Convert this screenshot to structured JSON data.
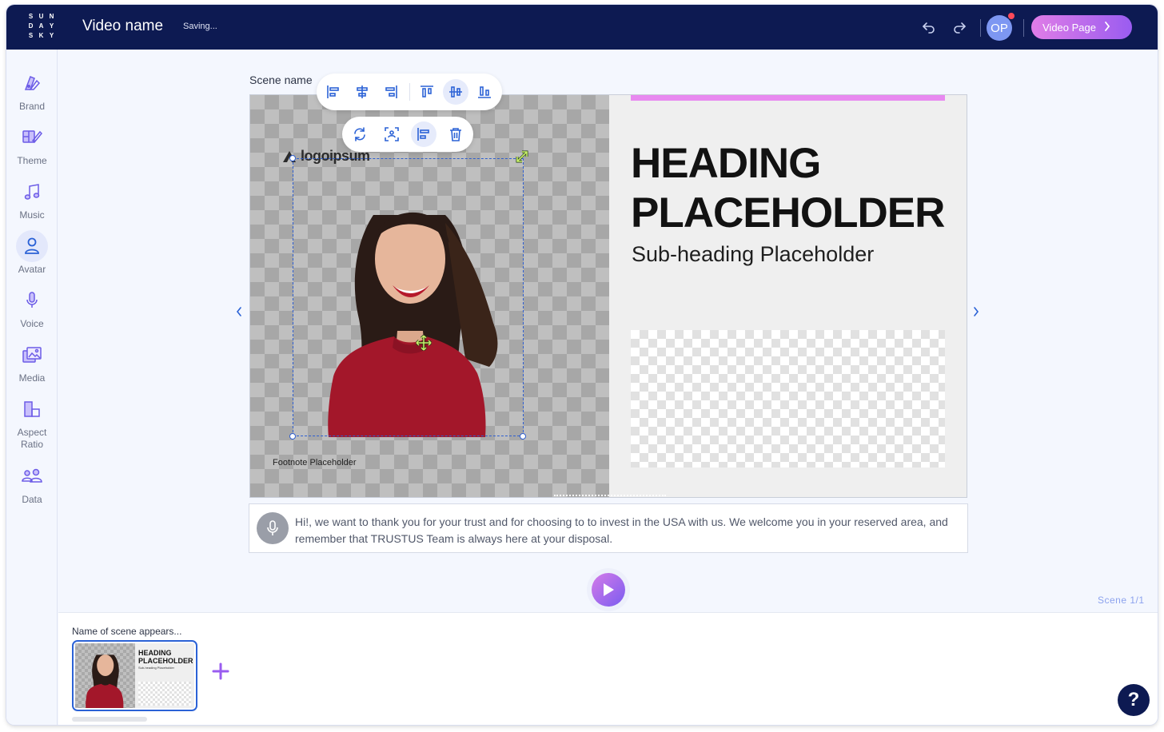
{
  "header": {
    "logo_letters": [
      "S",
      "U",
      "N",
      "D",
      "A",
      "Y",
      "S",
      "K",
      "Y"
    ],
    "title": "Video name",
    "status": "Saving...",
    "avatar_initials": "OP",
    "video_page_label": "Video Page",
    "icons": [
      "undo-icon",
      "redo-icon",
      "chevron-right-icon"
    ]
  },
  "sidebar": {
    "items": [
      {
        "label": "Brand",
        "icon": "palette-icon"
      },
      {
        "label": "Theme",
        "icon": "theme-icon"
      },
      {
        "label": "Music",
        "icon": "music-note-icon"
      },
      {
        "label": "Avatar",
        "icon": "person-icon",
        "active": true
      },
      {
        "label": "Voice",
        "icon": "microphone-icon"
      },
      {
        "label": "Media",
        "icon": "media-gallery-icon"
      },
      {
        "label": "Aspect Ratio",
        "icon": "aspect-ratio-icon"
      },
      {
        "label": "Data",
        "icon": "users-data-icon"
      }
    ]
  },
  "stage": {
    "scene_name": "Scene name",
    "heading": "HEADING PLACEHOLDER",
    "subheading": "Sub-heading Placeholder",
    "logo_text": "logoipsum",
    "footnote": "Footnote Placeholder",
    "align_toolbar": [
      "align-left-icon",
      "align-center-horizontal-icon",
      "align-right-icon",
      "align-top-icon",
      "align-center-vertical-icon",
      "align-bottom-icon"
    ],
    "action_toolbar": [
      "replace-icon",
      "focus-icon",
      "align-left-icon",
      "trash-icon"
    ],
    "colors": {
      "accent_bar": "#e889f0",
      "selection": "#2f5fd0",
      "header": "#0d1a52"
    }
  },
  "narration": {
    "text": "Hi!, we want to thank you for your trust and for choosing to to invest in the USA with us. We welcome you in your reserved area, and remember that TRUSTUS Team is always here at your disposal."
  },
  "timeline": {
    "scene_count": "Scene 1/1",
    "scene_appears": "Name of scene appears...",
    "thumb_heading": "HEADING PLACEHOLDER",
    "thumb_sub": "Sub-heading Placeholder",
    "help_label": "?"
  }
}
